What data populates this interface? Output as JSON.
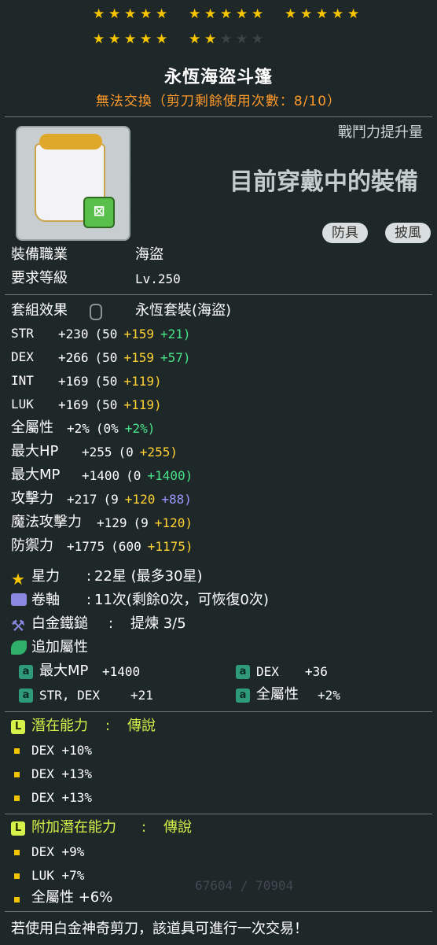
{
  "stars": {
    "total": 25,
    "filled": 22
  },
  "item": {
    "name": "永恆海盜斗篷",
    "trade_note": "無法交換（剪刀剩餘使用次數：8/10）"
  },
  "side": {
    "combat_label": "戰鬥力提升量",
    "equipped_label": "目前穿戴中的裝備",
    "tags": [
      "防具",
      "披風"
    ]
  },
  "req": {
    "job_label": "裝備職業",
    "job": "海盜",
    "level_label": "要求等級",
    "level": "Lv.250"
  },
  "set": {
    "label": "套組效果",
    "value": "永恆套裝(海盜)"
  },
  "stats": [
    {
      "name": "STR",
      "total": "+230",
      "base": "(50",
      "yel": "+159",
      "grn": "+21)",
      "blu": ""
    },
    {
      "name": "DEX",
      "total": "+266",
      "base": "(50",
      "yel": "+159",
      "grn": "+57)",
      "blu": ""
    },
    {
      "name": "INT",
      "total": "+169",
      "base": "(50",
      "yel": "+119)",
      "grn": "",
      "blu": ""
    },
    {
      "name": "LUK",
      "total": "+169",
      "base": "(50",
      "yel": "+119)",
      "grn": "",
      "blu": ""
    },
    {
      "name": "全屬性",
      "total": "+2%",
      "base": "(0%",
      "yel": "",
      "grn": "+2%)",
      "blu": ""
    },
    {
      "name": "最大HP",
      "total": "+255",
      "base": "(0",
      "yel": "+255)",
      "grn": "",
      "blu": ""
    },
    {
      "name": "最大MP",
      "total": "+1400",
      "base": "(0",
      "yel": "",
      "grn": "+1400)",
      "blu": ""
    },
    {
      "name": "攻擊力",
      "total": "+217",
      "base": "(9",
      "yel": "+120",
      "grn": "",
      "blu": "+88)"
    },
    {
      "name": "魔法攻擊力",
      "total": "+129",
      "base": "(9",
      "yel": "+120)",
      "grn": "",
      "blu": ""
    },
    {
      "name": "防禦力",
      "total": "+1775",
      "base": "(600",
      "yel": "+1175)",
      "grn": "",
      "blu": ""
    }
  ],
  "starforce": {
    "label": "星力",
    "value": "22星 (最多30星)"
  },
  "scroll": {
    "label": "卷軸",
    "value": "11次(剩餘0次，可恢復0次)"
  },
  "hammer": {
    "label": "白金鐵鎚",
    "value": "提煉 3/5"
  },
  "flame": {
    "label": "追加屬性",
    "items": [
      {
        "name": "最大MP",
        "value": "+1400"
      },
      {
        "name": "DEX",
        "value": "+36"
      },
      {
        "name": "STR, DEX",
        "value": "+21"
      },
      {
        "name": "全屬性",
        "value": "+2%"
      }
    ]
  },
  "potential": {
    "label": "潛在能力",
    "grade": "傳說",
    "lines": [
      "DEX +10%",
      "DEX +13%",
      "DEX +13%"
    ]
  },
  "bonus": {
    "label": "附加潛在能力",
    "grade": "傳說",
    "lines": [
      "DEX +9%",
      "LUK +7%",
      "全屬性 +6%"
    ]
  },
  "background_hp": "67604 / 70904",
  "footer": "若使用白金神奇剪刀，該道具可進行一次交易！",
  "colors": {
    "star": "#f7c600",
    "trade": "#ff9a2a",
    "epic_label": "#d6f24a",
    "yellow": "#ffd233",
    "green": "#48e48a",
    "blue": "#9c98ff"
  }
}
